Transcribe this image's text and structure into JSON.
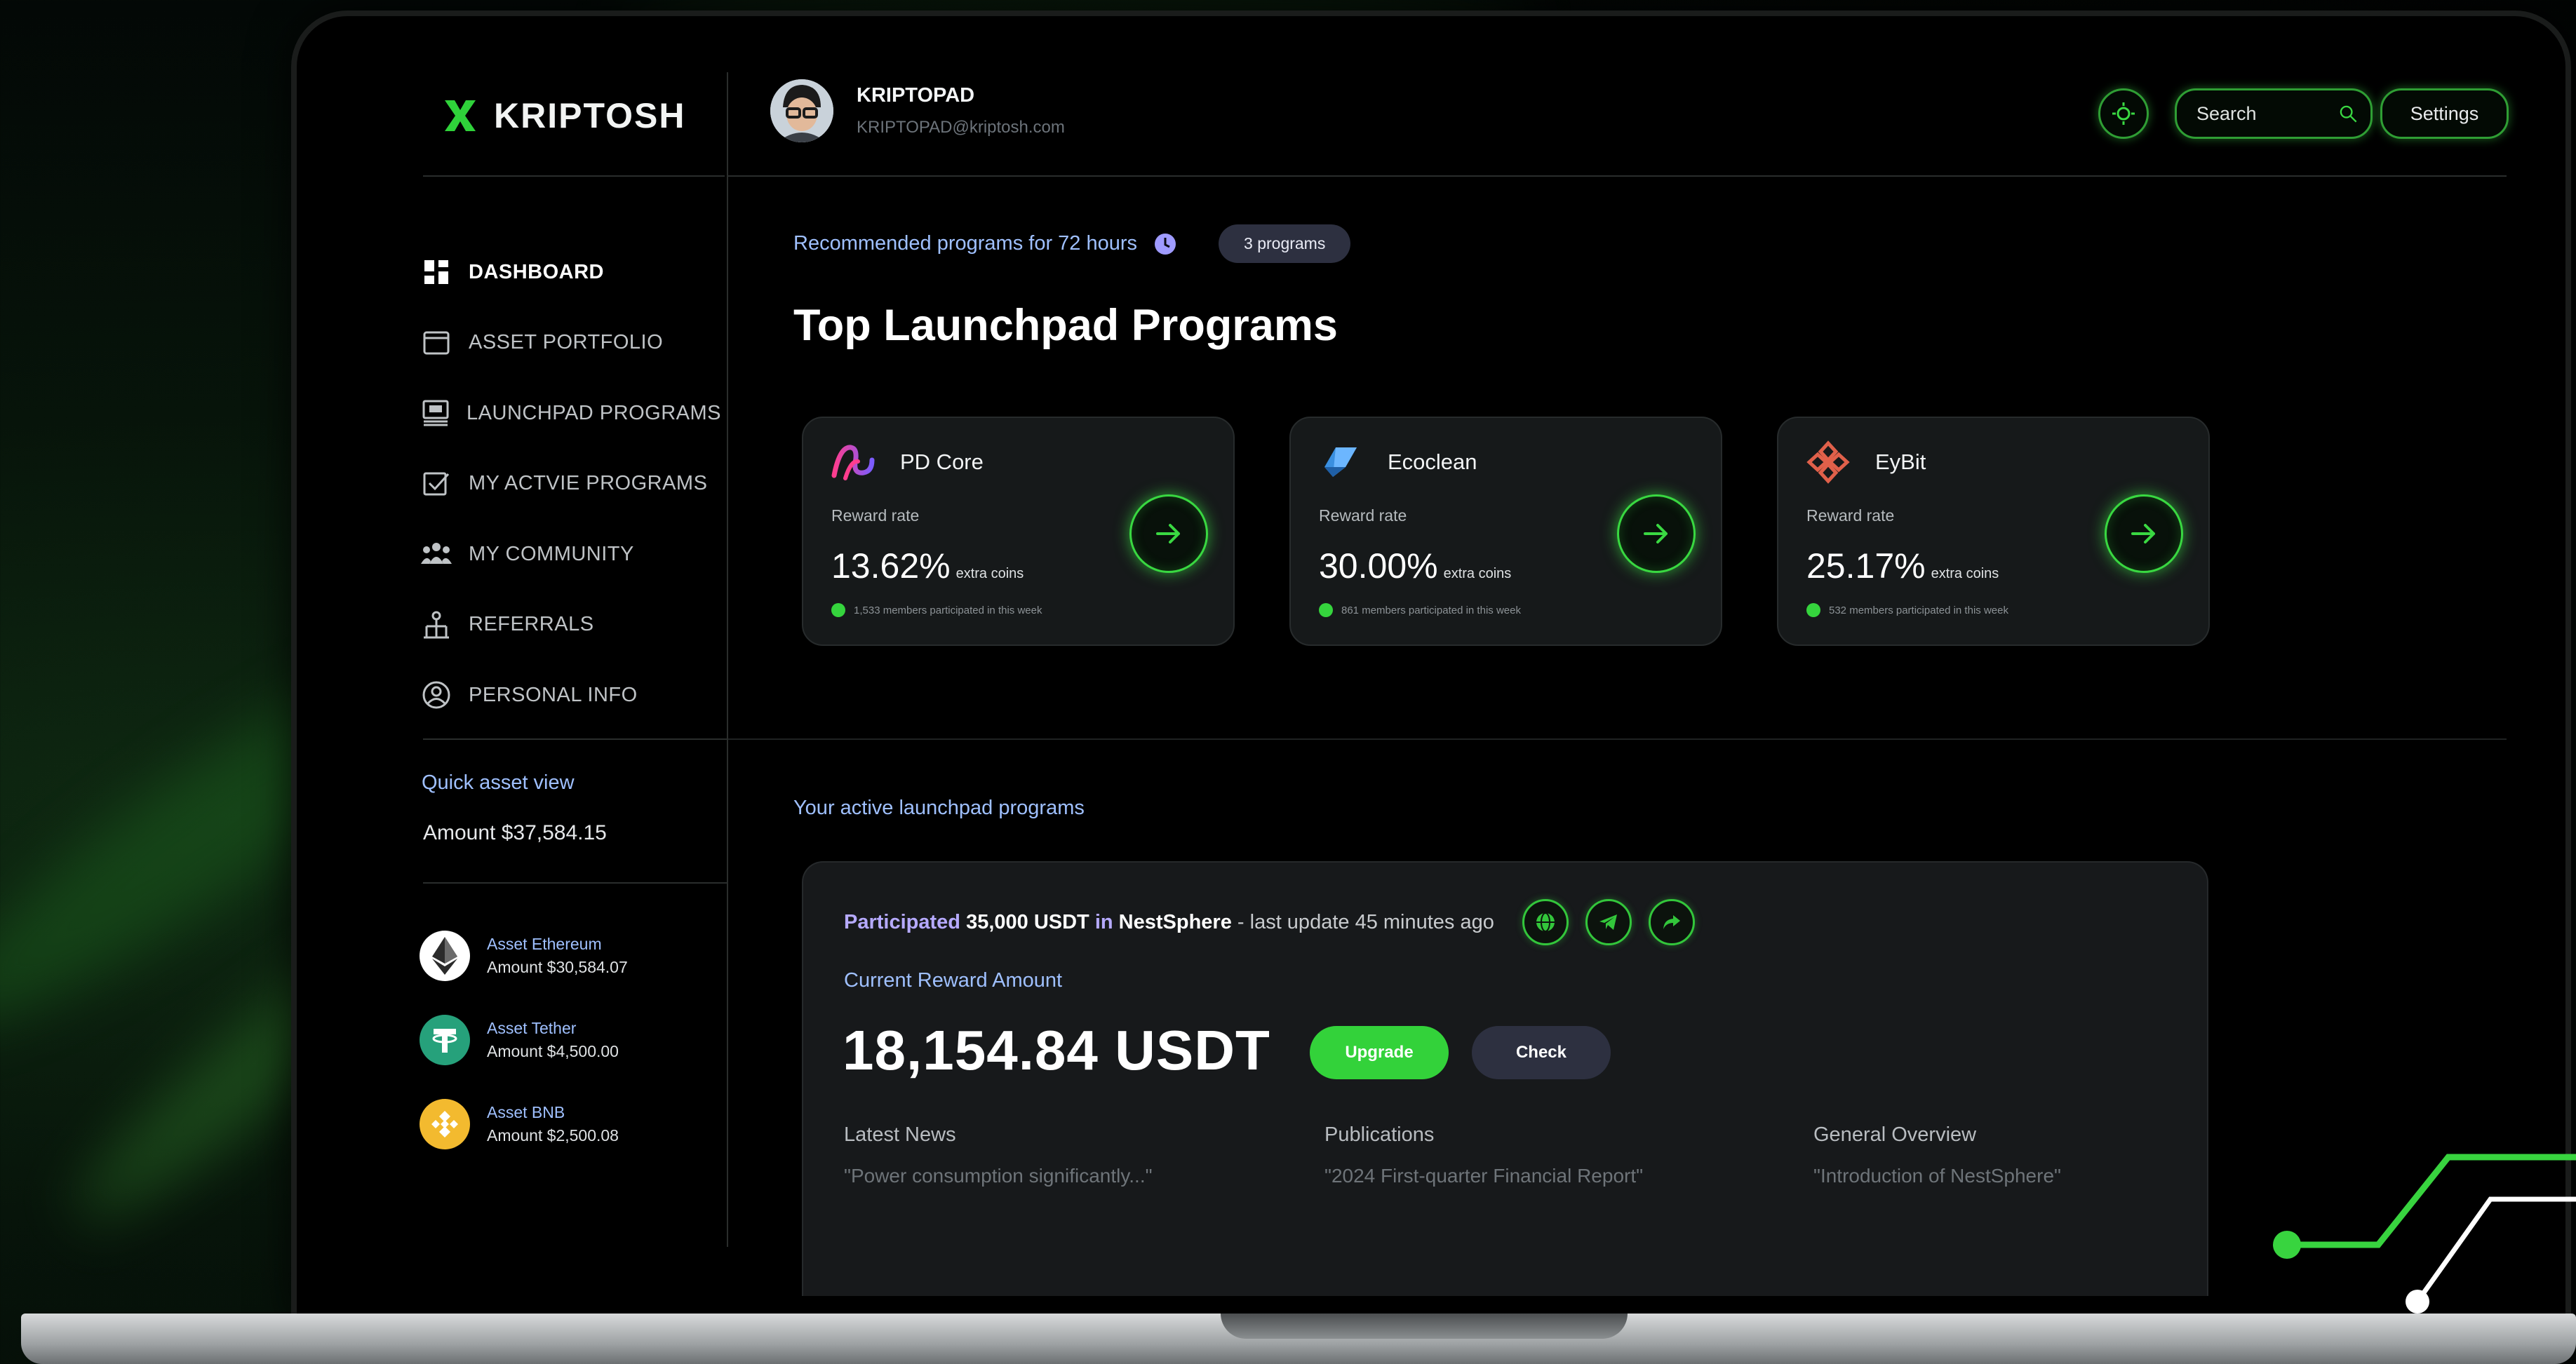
{
  "brand": {
    "name": "KRIPTOSH"
  },
  "user": {
    "name": "KRIPTOPAD",
    "email": "KRIPTOPAD@kriptosh.com"
  },
  "header": {
    "search_placeholder": "Search",
    "settings_label": "Settings"
  },
  "sidebar": {
    "items": [
      {
        "label": "DASHBOARD",
        "icon": "dashboard-icon",
        "active": true
      },
      {
        "label": "ASSET PORTFOLIO",
        "icon": "portfolio-icon",
        "active": false
      },
      {
        "label": "LAUNCHPAD PROGRAMS",
        "icon": "launchpad-icon",
        "active": false
      },
      {
        "label": "MY ACTVIE PROGRAMS",
        "icon": "checkbox-icon",
        "active": false
      },
      {
        "label": "MY COMMUNITY",
        "icon": "community-icon",
        "active": false
      },
      {
        "label": "REFERRALS",
        "icon": "referrals-icon",
        "active": false
      },
      {
        "label": "PERSONAL INFO",
        "icon": "user-icon",
        "active": false
      }
    ],
    "quick_title": "Quick asset view",
    "quick_amount": "Amount $37,584.15",
    "assets": [
      {
        "name": "Asset Ethereum",
        "amount": "Amount $30,584.07",
        "icon": "ethereum-icon",
        "color": "#ffffff"
      },
      {
        "name": "Asset Tether",
        "amount": "Amount $4,500.00",
        "icon": "tether-icon",
        "color": "#26a17b"
      },
      {
        "name": "Asset BNB",
        "amount": "Amount $2,500.08",
        "icon": "bnb-icon",
        "color": "#f3ba2f"
      }
    ]
  },
  "main": {
    "recommend_text": "Recommended programs for 72 hours",
    "badge": "3 programs",
    "title": "Top Launchpad Programs",
    "cards": [
      {
        "name": "PD Core",
        "label": "Reward rate",
        "rate": "13.62%",
        "suffix": "extra coins",
        "members": "1,533 members participated in this week"
      },
      {
        "name": "Ecoclean",
        "label": "Reward rate",
        "rate": "30.00%",
        "suffix": "extra coins",
        "members": "861 members participated in this week"
      },
      {
        "name": "EyBit",
        "label": "Reward rate",
        "rate": "25.17%",
        "suffix": "extra coins",
        "members": "532 members participated in this week"
      }
    ],
    "active_title": "Your active launchpad programs",
    "active": {
      "participated": "Participated",
      "amount": "35,000 USDT",
      "in": "in",
      "project": "NestSphere",
      "update": "- last update 45 minutes ago",
      "current_label": "Current Reward Amount",
      "current_value": "18,154.84 USDT",
      "upgrade": "Upgrade",
      "check": "Check",
      "columns": [
        {
          "head": "Latest News",
          "text": "\"Power consumption significantly...\""
        },
        {
          "head": "Publications",
          "text": "\"2024 First-quarter Financial Report\""
        },
        {
          "head": "General Overview",
          "text": "\"Introduction of NestSphere\""
        }
      ]
    }
  },
  "colors": {
    "accent": "#35d43d",
    "link": "#9fc0ff",
    "highlight": "#b6aaff",
    "background": "#000000"
  }
}
